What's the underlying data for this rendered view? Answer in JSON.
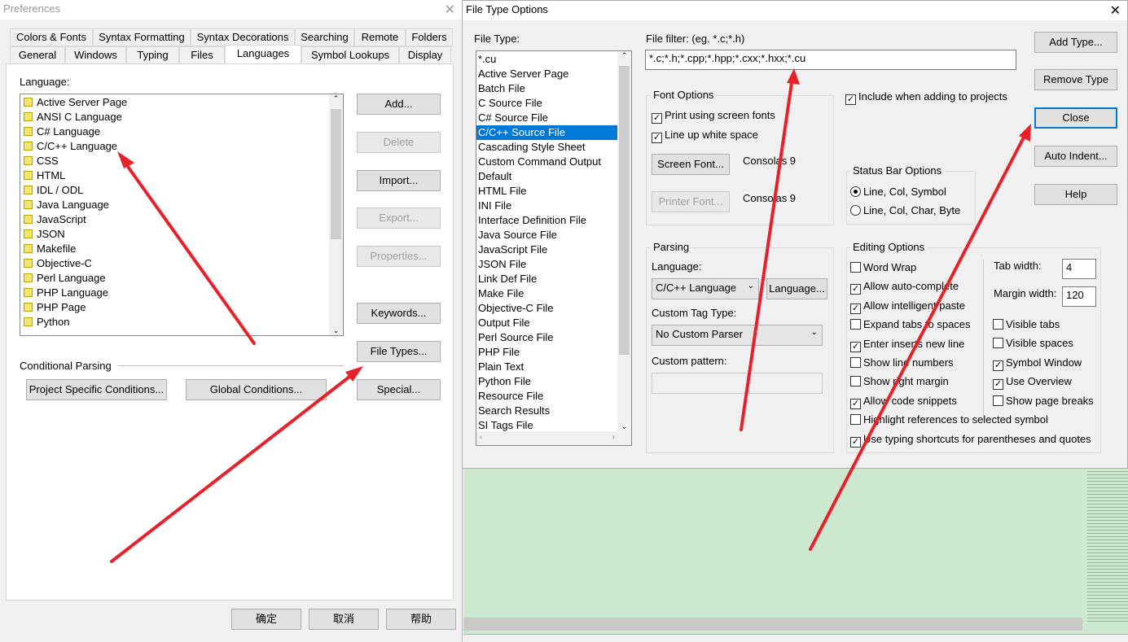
{
  "preferences": {
    "title": "Preferences",
    "tabs_row1": [
      "Colors & Fonts",
      "Syntax Formatting",
      "Syntax Decorations",
      "Searching",
      "Remote",
      "Folders"
    ],
    "tabs_row2": [
      "General",
      "Windows",
      "Typing",
      "Files",
      "Languages",
      "Symbol Lookups",
      "Display"
    ],
    "active_tab": "Languages",
    "language_label": "Language:",
    "languages": [
      "Active Server Page",
      "ANSI C Language",
      "C# Language",
      "C/C++ Language",
      "CSS",
      "HTML",
      "IDL / ODL",
      "Java Language",
      "JavaScript",
      "JSON",
      "Makefile",
      "Objective-C",
      "Perl Language",
      "PHP Language",
      "PHP Page",
      "Python"
    ],
    "buttons": {
      "add": "Add...",
      "delete": "Delete",
      "import": "Import...",
      "export": "Export...",
      "properties": "Properties...",
      "keywords": "Keywords...",
      "file_types": "File Types...",
      "special": "Special..."
    },
    "conditional_parsing": "Conditional Parsing",
    "project_conditions": "Project Specific Conditions...",
    "global_conditions": "Global Conditions...",
    "ok": "确定",
    "cancel": "取消",
    "help": "帮助"
  },
  "file_type_options": {
    "title": "File Type Options",
    "file_type_label": "File Type:",
    "file_types": [
      "*.cu",
      "Active Server Page",
      "Batch File",
      "C Source File",
      "C# Source File",
      "C/C++ Source File",
      "Cascading Style Sheet",
      "Custom Command Output",
      "Default",
      "HTML File",
      "INI File",
      "Interface Definition File",
      "Java Source File",
      "JavaScript File",
      "JSON File",
      "Link Def File",
      "Make File",
      "Objective-C File",
      "Output File",
      "Perl Source File",
      "PHP File",
      "Plain Text",
      "Python File",
      "Resource File",
      "Search Results",
      "SI Tags File"
    ],
    "selected_file_type": "C/C++ Source File",
    "file_filter_label": "File filter: (eg. *.c;*.h)",
    "file_filter_value": "*.c;*.h;*.cpp;*.hpp;*.cxx;*.hxx;*.cu",
    "include_projects": {
      "label": "Include when adding to projects",
      "checked": true
    },
    "font_options": {
      "label": "Font Options",
      "print_screen_fonts": {
        "label": "Print using screen fonts",
        "checked": true
      },
      "line_up": {
        "label": "Line up white space",
        "checked": true
      },
      "screen_font_btn": "Screen Font...",
      "screen_font": "Consolas 9",
      "printer_font_btn": "Printer Font...",
      "printer_font": "Consolas 9"
    },
    "status_bar": {
      "label": "Status Bar Options",
      "options": [
        "Line, Col, Symbol",
        "Line, Col, Char, Byte"
      ],
      "selected": "Line, Col, Symbol"
    },
    "parsing": {
      "label": "Parsing",
      "language_label": "Language:",
      "language_value": "C/C++ Language",
      "language_btn": "Language...",
      "tag_type_label": "Custom Tag Type:",
      "tag_type_value": "No Custom Parser",
      "pattern_label": "Custom pattern:",
      "pattern_value": ""
    },
    "editing": {
      "label": "Editing Options",
      "left": [
        {
          "label": "Word Wrap",
          "checked": false
        },
        {
          "label": "Allow auto-complete",
          "checked": true
        },
        {
          "label": "Allow intelligent paste",
          "checked": true
        },
        {
          "label": "Expand tabs to spaces",
          "checked": false
        },
        {
          "label": "Enter inserts new line",
          "checked": true
        },
        {
          "label": "Show line numbers",
          "checked": false
        },
        {
          "label": "Show right margin",
          "checked": false
        },
        {
          "label": "Allow code snippets",
          "checked": true
        }
      ],
      "right": [
        {
          "label": "Visible tabs",
          "checked": false
        },
        {
          "label": "Visible spaces",
          "checked": false
        },
        {
          "label": "Symbol Window",
          "checked": true
        },
        {
          "label": "Use Overview",
          "checked": true
        },
        {
          "label": "Show page breaks",
          "checked": false
        }
      ],
      "bottom": [
        {
          "label": "Highlight references to selected symbol",
          "checked": false
        },
        {
          "label": "Use typing shortcuts for parentheses and quotes",
          "checked": true
        }
      ],
      "tab_width_label": "Tab width:",
      "tab_width": "4",
      "margin_width_label": "Margin width:",
      "margin_width": "120"
    },
    "buttons": {
      "add_type": "Add Type...",
      "remove_type": "Remove Type",
      "close": "Close",
      "auto_indent": "Auto Indent...",
      "help": "Help"
    }
  },
  "colors": {
    "accent": "#0078d7",
    "arrow": "#e8202a",
    "editor_bg": "#cce8cf"
  }
}
